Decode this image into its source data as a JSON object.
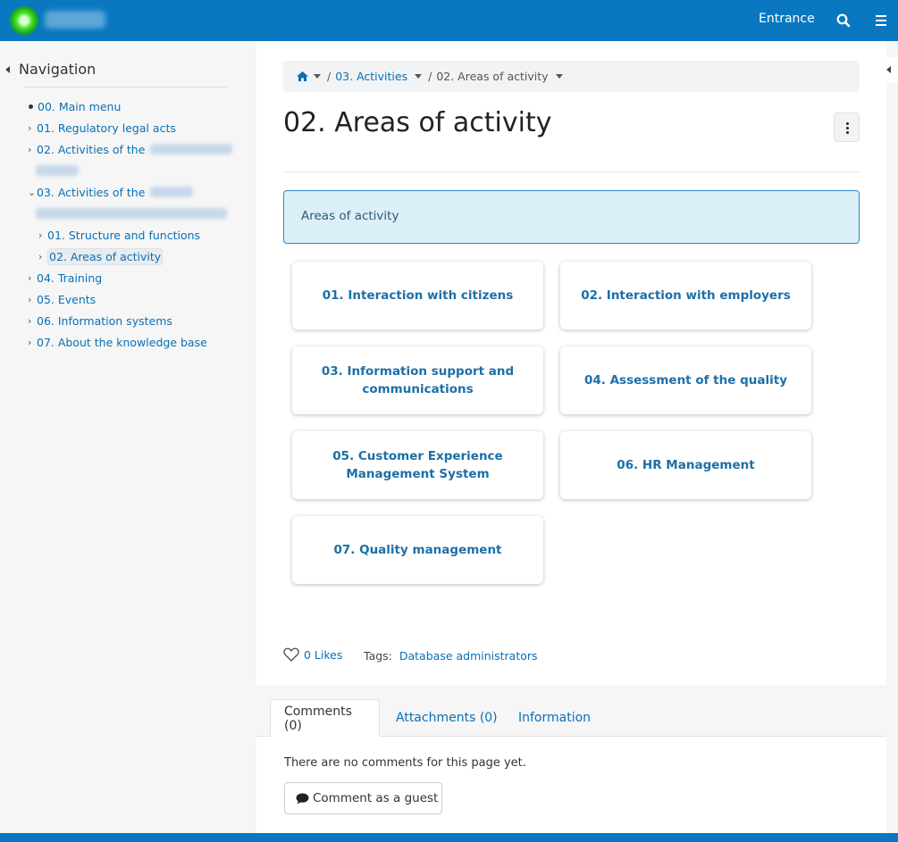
{
  "header": {
    "entrance_label": "Entrance",
    "search_icon": "search-icon",
    "menu_icon": "hamburger-icon",
    "brand_color": "#0a78c0"
  },
  "sidebar": {
    "heading": "Navigation",
    "items": [
      {
        "label": "00. Main menu",
        "marker": "dot"
      },
      {
        "label": "01. Regulatory legal acts",
        "marker": "chevron-right"
      },
      {
        "label": "02. Activities of the",
        "marker": "chevron-right"
      },
      {
        "label": "03. Activities of the",
        "marker": "chevron-down"
      },
      {
        "label": "01. Structure and functions",
        "marker": "chevron-right"
      },
      {
        "label": "02. Areas of activity",
        "marker": "chevron-right",
        "active": true
      },
      {
        "label": "04. Training",
        "marker": "chevron-right"
      },
      {
        "label": "05. Events",
        "marker": "chevron-right"
      },
      {
        "label": "06. Information systems",
        "marker": "chevron-right"
      },
      {
        "label": "07. About the knowledge base",
        "marker": "chevron-right"
      }
    ]
  },
  "breadcrumb": {
    "home_icon": "home-icon",
    "items": [
      "03. Activities",
      "02. Areas of activity"
    ]
  },
  "page": {
    "title": "02. Areas of activity",
    "info_text": "Areas of activity",
    "tiles": [
      "01. Interaction with citizens",
      "02. Interaction with employers",
      "03. Information support and communications",
      "04. Assessment of the quality",
      "05. Customer Experience Management System",
      "06. HR Management",
      "07. Quality management"
    ],
    "likes": "0 Likes",
    "tags_label": "Tags:",
    "tags": [
      "Database administrators"
    ]
  },
  "tabs": [
    {
      "label": "Comments (0)",
      "active": true
    },
    {
      "label": "Attachments (0)",
      "active": false
    },
    {
      "label": "Information",
      "active": false
    }
  ],
  "comments": {
    "empty_text": "There are no comments for this page yet.",
    "guest_button": "Comment as a guest"
  }
}
